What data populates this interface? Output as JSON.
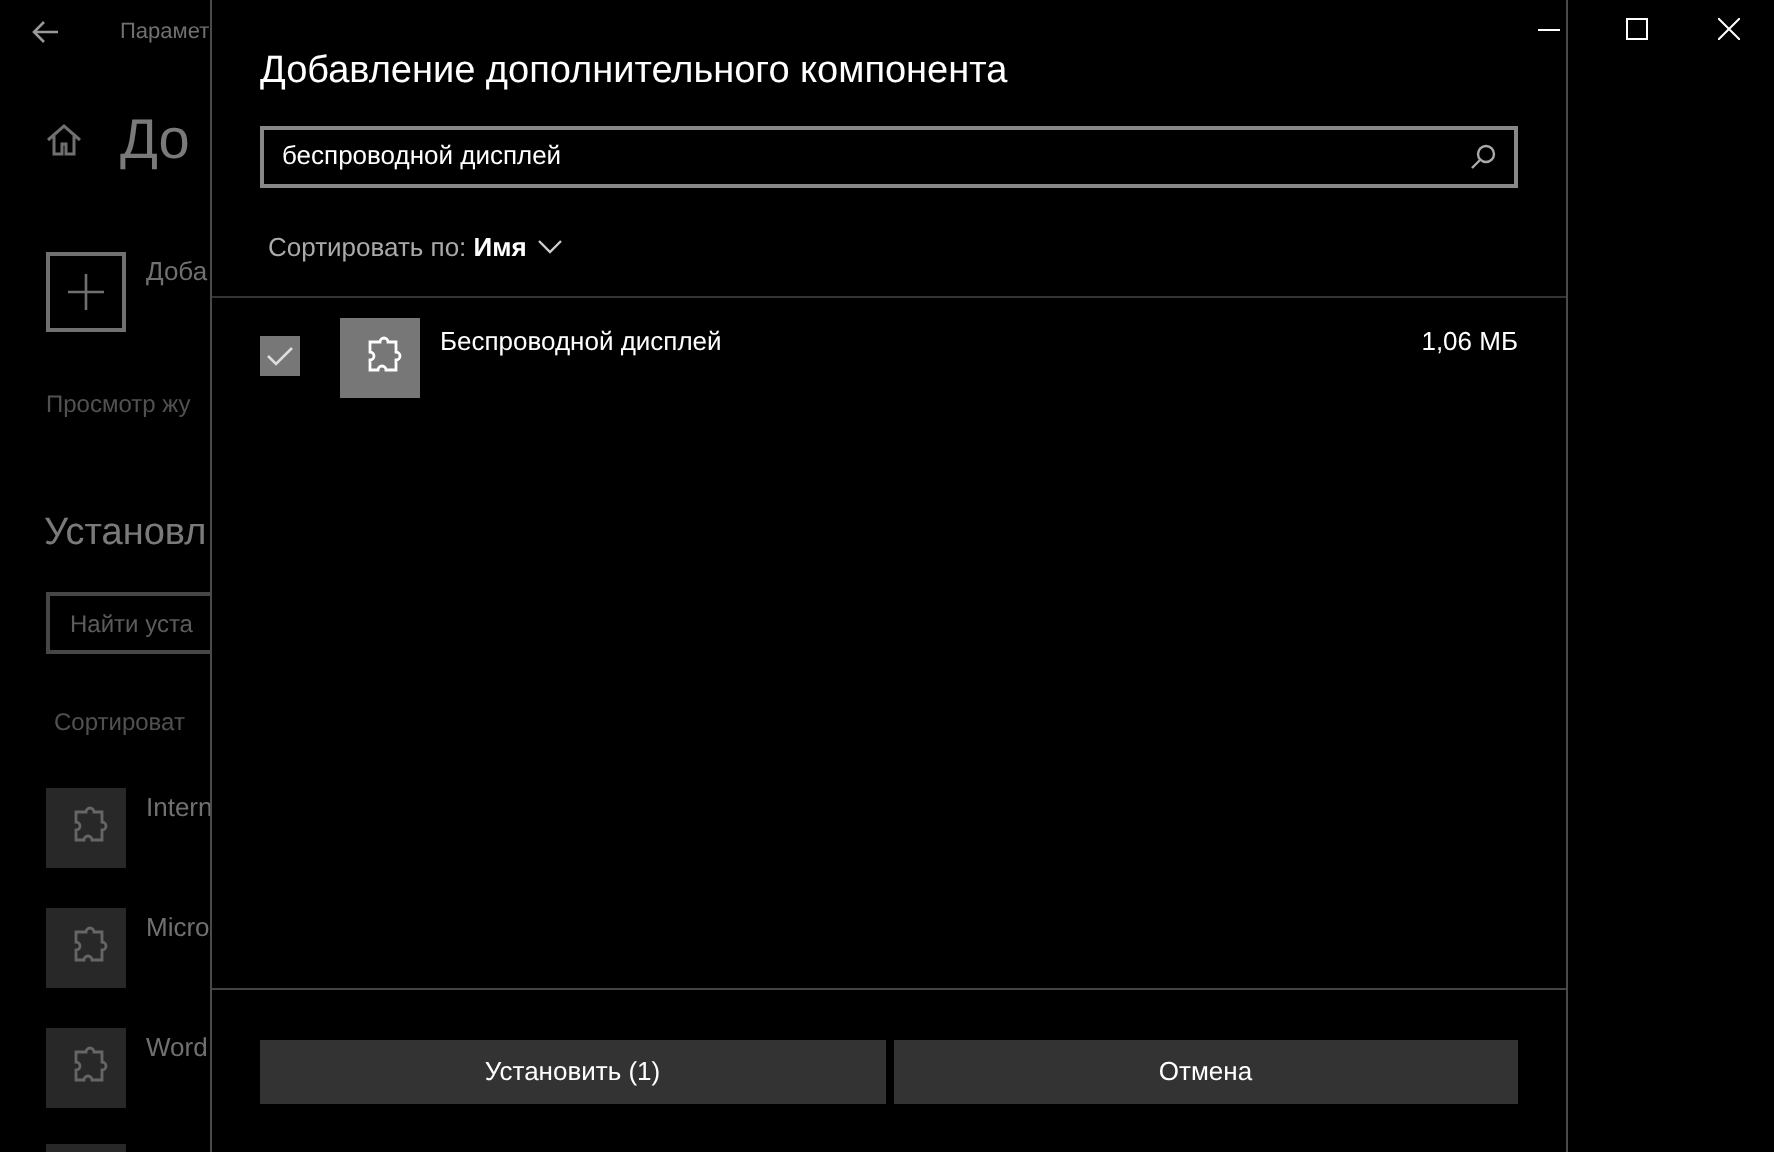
{
  "background": {
    "window_title": "Парамет",
    "page_heading": "До",
    "add_label": "Доба",
    "history_link": "Просмотр жу",
    "installed_heading": "Установл",
    "search_placeholder": "Найти уста",
    "sort_label": "Сортироват",
    "installed_items": [
      {
        "name": "Intern"
      },
      {
        "name": "Micro"
      },
      {
        "name": "Word"
      }
    ]
  },
  "dialog": {
    "title": "Добавление дополнительного компонента",
    "search": {
      "value": "беспроводной дисплей"
    },
    "sort": {
      "label": "Сортировать по:",
      "value": "Имя"
    },
    "items": [
      {
        "name": "Беспроводной дисплей",
        "size": "1,06 МБ",
        "checked": true
      }
    ],
    "buttons": [
      {
        "label": "Установить (1)"
      },
      {
        "label": "Отмена"
      }
    ]
  }
}
